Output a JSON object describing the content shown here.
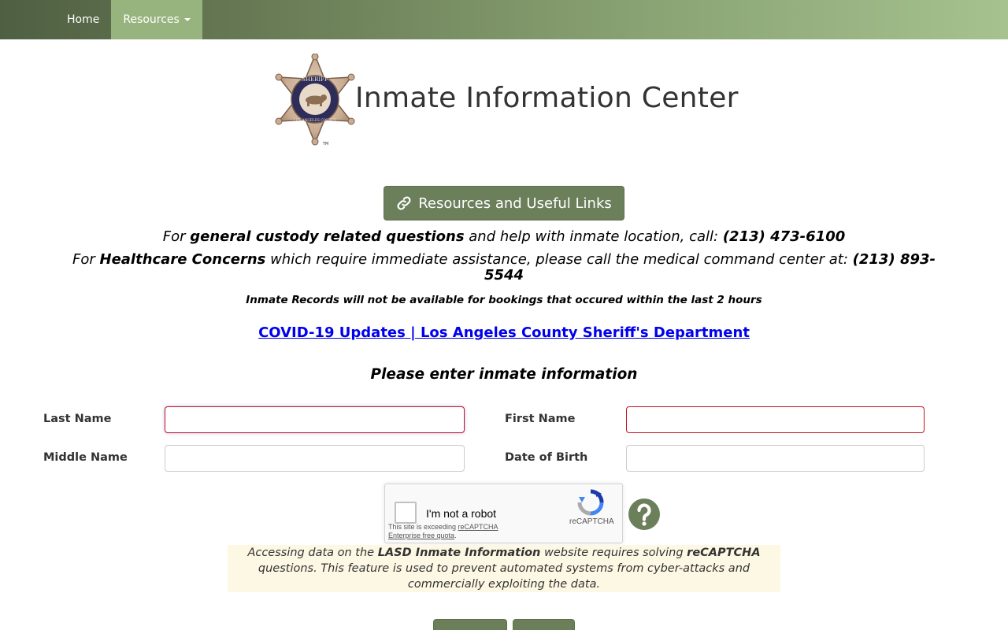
{
  "nav": {
    "home_label": "Home",
    "resources_label": "Resources"
  },
  "header": {
    "title": "Inmate Information Center",
    "badge_top_text": "SHERIFF",
    "badge_bottom_text": "LOS ANGELES COUNTY",
    "badge_tm": "TM"
  },
  "resources_button": {
    "label": "Resources and Useful Links"
  },
  "info": {
    "line1_pre": "For ",
    "line1_bold": "general custody related questions",
    "line1_mid": " and help with inmate location, call: ",
    "line1_phone": "(213) 473-6100",
    "line2_pre": "For ",
    "line2_bold": "Healthcare Concerns",
    "line2_mid": " which require immediate assistance, please call the medical command center at: ",
    "line2_phone": "(213) 893-5544",
    "line3": "Inmate Records will not be available for bookings that occured within the last 2 hours"
  },
  "covid_link": "COVID-19 Updates | Los Angeles County Sheriff's Department",
  "form": {
    "heading": "Please enter inmate information",
    "last_name_label": "Last Name",
    "first_name_label": "First Name",
    "middle_name_label": "Middle Name",
    "dob_label": "Date of Birth",
    "last_name_value": "",
    "first_name_value": "",
    "middle_name_value": "",
    "dob_value": ""
  },
  "captcha": {
    "label": "I'm not a robot",
    "warning_pre": "This site is exceeding ",
    "warning_link": "reCAPTCHA Enterprise free quota",
    "warning_post": ".",
    "brand": "reCAPTCHA"
  },
  "notice": {
    "pre": "Accessing data on the ",
    "bold1": "LASD Inmate Information",
    "mid": " website requires solving ",
    "bold2": "reCAPTCHA",
    "post": " questions. This feature is used to prevent automated systems from cyber-attacks and commercially exploiting the data."
  },
  "colors": {
    "accent": "#6b7f5a",
    "required_border": "#c4161c",
    "notice_bg": "#fdf8e4",
    "link": "#0000ee"
  },
  "icons": {
    "resources_button": "link-icon",
    "help": "question-circle-icon",
    "captcha": "recaptcha-logo-icon"
  }
}
